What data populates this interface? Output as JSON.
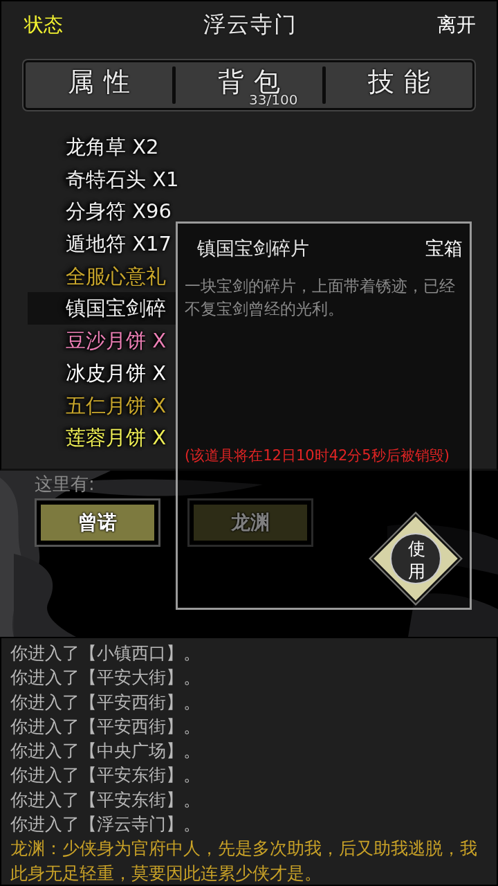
{
  "header": {
    "status_link": "状态",
    "title": "浮云寺门",
    "leave_link": "离开"
  },
  "tabs": [
    {
      "label": "属性"
    },
    {
      "label": "背包",
      "count": "33/100"
    },
    {
      "label": "技能"
    }
  ],
  "items": [
    {
      "name": "龙角草 X2",
      "color": "#f2f2f2",
      "selected": false
    },
    {
      "name": "奇特石头 X1",
      "color": "#f2f2f2",
      "selected": false
    },
    {
      "name": "分身符 X96",
      "color": "#f2f2f2",
      "selected": false
    },
    {
      "name": "遁地符 X17",
      "color": "#f2f2f2",
      "selected": false
    },
    {
      "name": "全服心意礼",
      "color": "#c9a72c",
      "selected": false
    },
    {
      "name": "镇国宝剑碎",
      "color": "#f2f2f2",
      "selected": true
    },
    {
      "name": "豆沙月饼 X",
      "color": "#ec7fb5",
      "selected": false
    },
    {
      "name": "冰皮月饼 X",
      "color": "#ffffff",
      "selected": false
    },
    {
      "name": "五仁月饼 X",
      "color": "#c9a72c",
      "selected": false
    },
    {
      "name": "莲蓉月饼 X",
      "color": "#eeee55",
      "selected": false
    }
  ],
  "scene": {
    "label": "这里有:",
    "npcs": [
      {
        "name": "曾诺"
      },
      {
        "name": "龙渊"
      }
    ]
  },
  "item_popup": {
    "name": "镇国宝剑碎片",
    "type": "宝箱",
    "description": "一块宝剑的碎片，上面带着锈迹，已经不复宝剑曾经的光利。",
    "expiry": "(该道具将在12日10时42分5秒后被销毁)",
    "use_button": "使用"
  },
  "log": [
    {
      "kind": "system",
      "text": "你进入了【小镇西口】。"
    },
    {
      "kind": "system",
      "text": "你进入了【平安大街】。"
    },
    {
      "kind": "system",
      "text": "你进入了【平安西街】。"
    },
    {
      "kind": "system",
      "text": "你进入了【平安西街】。"
    },
    {
      "kind": "system",
      "text": "你进入了【中央广场】。"
    },
    {
      "kind": "system",
      "text": "你进入了【平安东街】。"
    },
    {
      "kind": "system",
      "text": "你进入了【平安东街】。"
    },
    {
      "kind": "system",
      "text": "你进入了【浮云寺门】。"
    },
    {
      "kind": "speech",
      "text": "龙渊：少侠身为官府中人，先是多次助我，后又助我逃脱，我此身无足轻重，莫要因此连累少侠才是。"
    }
  ]
}
